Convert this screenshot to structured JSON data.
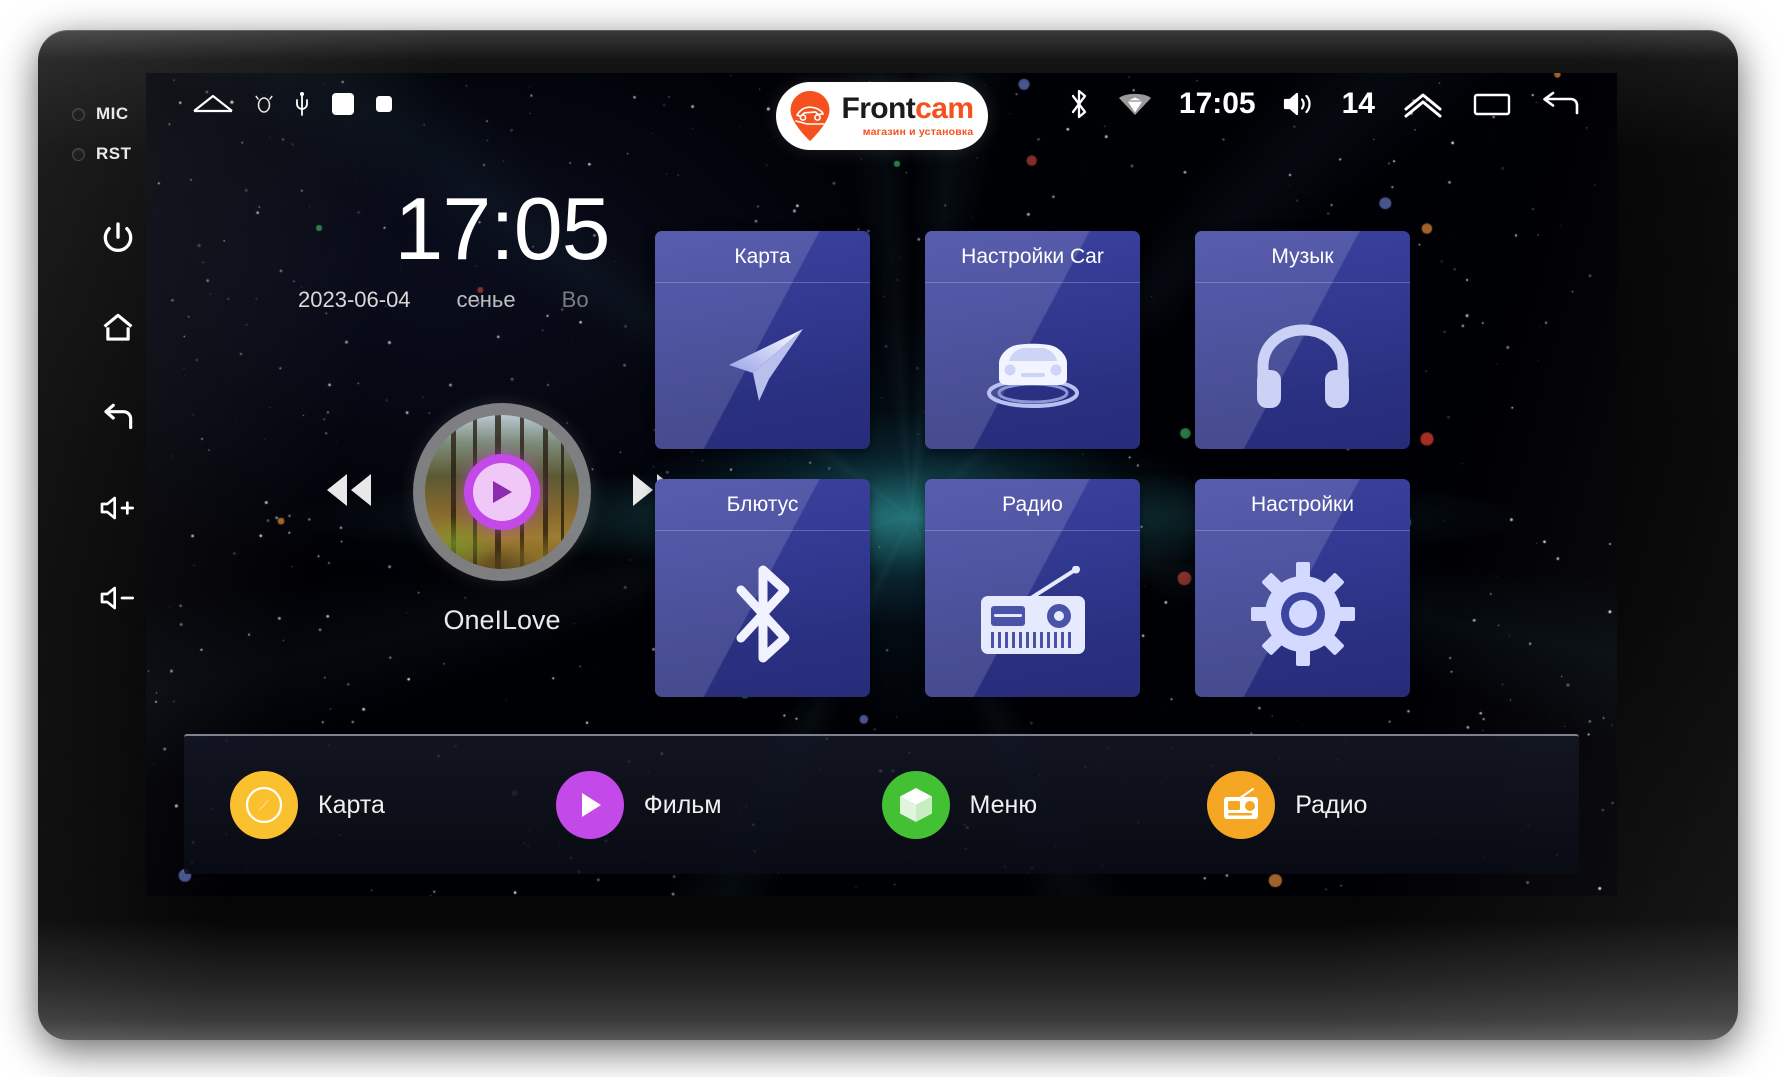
{
  "device": {
    "hardware_buttons": [
      {
        "name": "mic-indicator",
        "label": "MIC"
      },
      {
        "name": "reset-indicator",
        "label": "RST"
      },
      {
        "name": "power-button",
        "label": "power"
      },
      {
        "name": "home-button",
        "label": "home"
      },
      {
        "name": "back-button",
        "label": "back"
      },
      {
        "name": "volume-up-button",
        "label": "volume up"
      },
      {
        "name": "volume-down-button",
        "label": "volume down"
      }
    ]
  },
  "statusbar": {
    "nav_icons": [
      "home-outline-icon",
      "tpms-icon",
      "usb-icon",
      "square-filled-icon",
      "square-small-icon"
    ],
    "brand": {
      "name_part1": "Front",
      "name_part2": "cam",
      "tagline": "магазин и установка",
      "accent_color": "#f4511e"
    },
    "bluetooth_icon": "bluetooth-icon",
    "wifi_icon": "wifi-icon",
    "time": "17:05",
    "volume_icon": "volume-icon",
    "volume_level": "14",
    "expand_icon": "chevron-up-icon",
    "recents_icon": "recents-icon",
    "back_icon": "back-arrow-icon"
  },
  "clock": {
    "time": "17:05",
    "date": "2023-06-04",
    "weekday": "сенье",
    "weekday_secondary": "Во"
  },
  "player": {
    "prev_icon": "rewind-icon",
    "next_icon": "fast-forward-icon",
    "play_icon": "play-icon",
    "album_art": "forest-album-art",
    "track_name": "OneILove",
    "play_button_color": "#c34ae8"
  },
  "tiles": [
    {
      "label": "Карта",
      "icon": "paper-plane-icon"
    },
    {
      "label": "Настройки Car",
      "icon": "car-front-icon"
    },
    {
      "label": "Музык",
      "icon": "headphones-icon"
    },
    {
      "label": "Блютус",
      "icon": "bluetooth-icon"
    },
    {
      "label": "Радио",
      "icon": "radio-icon"
    },
    {
      "label": "Настройки",
      "icon": "gear-icon"
    }
  ],
  "dock": [
    {
      "label": "Карта",
      "icon": "compass-icon",
      "color": "#fbc02d"
    },
    {
      "label": "Фильм",
      "icon": "play-icon",
      "color": "#c34ae8"
    },
    {
      "label": "Меню",
      "icon": "cube-icon",
      "color": "#43c034"
    },
    {
      "label": "Радио",
      "icon": "radio-icon",
      "color": "#f5a623"
    }
  ]
}
